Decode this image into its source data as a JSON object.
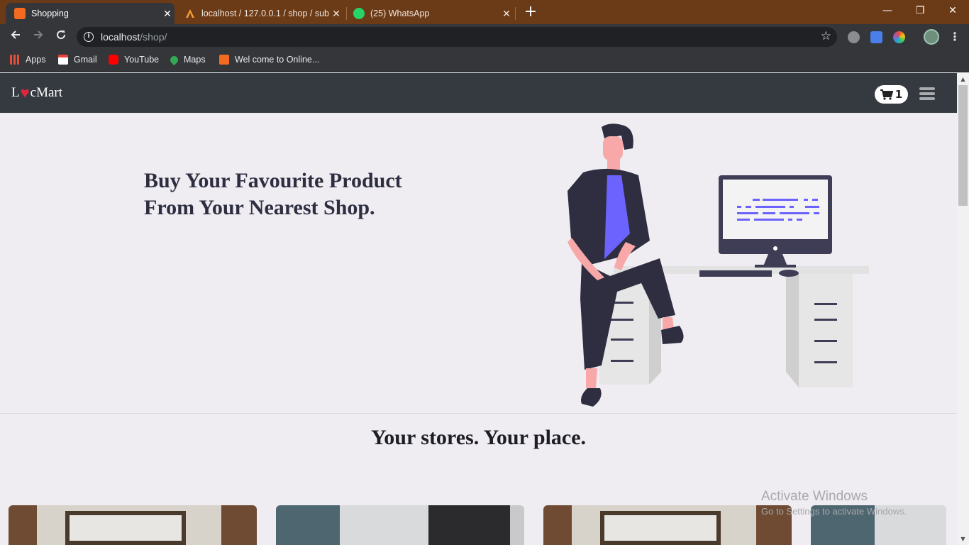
{
  "browser": {
    "tabs": [
      {
        "title": "Shopping",
        "favicon": "xampp-icon",
        "active": true
      },
      {
        "title": "localhost / 127.0.0.1 / shop / sub",
        "favicon": "phpmyadmin-icon",
        "active": false
      },
      {
        "title": "(25) WhatsApp",
        "favicon": "whatsapp-icon",
        "active": false
      }
    ],
    "close_glyph": "✕",
    "new_tab_glyph": "+",
    "window_controls": {
      "minimize": "—",
      "restore": "❐",
      "close": "✕"
    },
    "address": {
      "host": "localhost",
      "path": "/shop/"
    },
    "bookmarks": [
      {
        "label": "Apps",
        "icon": "apps-grid-icon"
      },
      {
        "label": "Gmail",
        "icon": "gmail-icon"
      },
      {
        "label": "YouTube",
        "icon": "youtube-icon"
      },
      {
        "label": "Maps",
        "icon": "maps-icon"
      },
      {
        "label": "Wel come to Online...",
        "icon": "xampp-icon"
      }
    ]
  },
  "site": {
    "brand_prefix": "L",
    "brand_heart": "♥",
    "brand_suffix": "cMart",
    "cart_count": "1",
    "hero_title_line1": "Buy Your Favourite Product",
    "hero_title_line2": "From Your Nearest Shop.",
    "tagline": "Your stores. Your place.",
    "colors": {
      "navbar": "#343a40",
      "hero_bg": "#efedf2",
      "accent": "#6c63ff",
      "dark": "#2f2e41",
      "skin": "#f8a8a8"
    }
  },
  "os_watermark": {
    "line1": "Activate Windows",
    "line2": "Go to Settings to activate Windows."
  }
}
